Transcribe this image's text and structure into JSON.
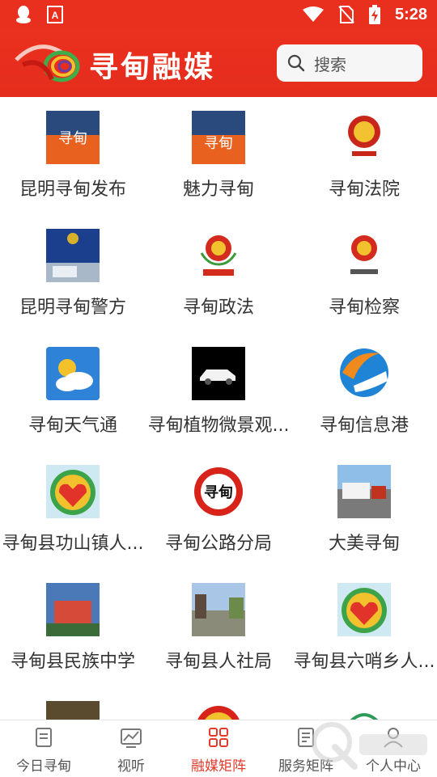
{
  "status_bar": {
    "time": "5:28"
  },
  "header": {
    "title": "寻甸融媒",
    "search_placeholder": "搜索"
  },
  "grid": {
    "items": [
      {
        "label": "昆明寻甸发布"
      },
      {
        "label": "魅力寻甸"
      },
      {
        "label": "寻甸法院"
      },
      {
        "label": "昆明寻甸警方"
      },
      {
        "label": "寻甸政法"
      },
      {
        "label": "寻甸检察"
      },
      {
        "label": "寻甸天气通"
      },
      {
        "label": "寻甸植物微景观..."
      },
      {
        "label": "寻甸信息港"
      },
      {
        "label": "寻甸县功山镇人..."
      },
      {
        "label": "寻甸公路分局"
      },
      {
        "label": "大美寻甸"
      },
      {
        "label": "寻甸县民族中学"
      },
      {
        "label": "寻甸县人社局"
      },
      {
        "label": "寻甸县六哨乡人..."
      },
      {
        "label": ""
      },
      {
        "label": ""
      },
      {
        "label": ""
      }
    ]
  },
  "nav": {
    "tabs": [
      {
        "label": "今日寻甸",
        "icon": "doc-icon"
      },
      {
        "label": "视听",
        "icon": "chart-icon"
      },
      {
        "label": "融媒矩阵",
        "icon": "matrix-icon",
        "active": true
      },
      {
        "label": "服务矩阵",
        "icon": "service-icon"
      },
      {
        "label": "个人中心",
        "icon": "person-icon"
      }
    ]
  },
  "colors": {
    "brand": "#e9301f",
    "active_tab": "#e23b2c"
  }
}
